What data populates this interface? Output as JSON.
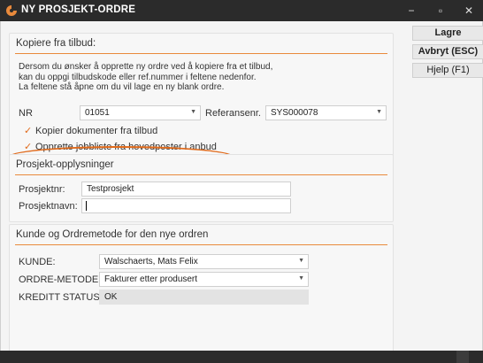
{
  "window": {
    "title": "NY PROSJEKT-ORDRE",
    "app_icon": "order-logo-icon",
    "minimize": "−",
    "maximize": "▫",
    "close": "✕"
  },
  "side_buttons": {
    "save": "Lagre",
    "cancel": "Avbryt (ESC)",
    "help": "Hjelp (F1)"
  },
  "copy_group": {
    "title": "Kopiere fra tilbud:",
    "info": [
      "Dersom du ønsker å opprette ny ordre ved å kopiere fra et tilbud,",
      "kan du oppgi tilbudskode eller ref.nummer i feltene nedenfor.",
      "La feltene stå åpne om du vil lage en ny blank ordre."
    ],
    "nr_label": "NR",
    "nr_value": "01051",
    "ref_label": "Referansenr.",
    "ref_value": "SYS000078",
    "copy_docs": "Kopier dokumenter fra tilbud",
    "create_joblist": "Opprette jobbliste fra hovedposter i anbud",
    "check_mark": "✓"
  },
  "project_group": {
    "title": "Prosjekt-opplysninger",
    "projnr_label": "Prosjektnr:",
    "projnr_value": "Testprosjekt",
    "projname_label": "Prosjektnavn:",
    "projname_value": ""
  },
  "customer_group": {
    "title": "Kunde og Ordremetode for den nye ordren",
    "customer_label": "KUNDE:",
    "customer_value": "Walschaerts, Mats Felix",
    "method_label": "ORDRE-METODE:",
    "method_value": "Fakturer etter produsert",
    "credit_label": "KREDITT STATUS:",
    "credit_value": "OK"
  },
  "icons": {
    "dropdown": "▼"
  },
  "colors": {
    "accent": "#e98a3c",
    "highlight": "#e06a1b",
    "titlebar": "#2b2b2b"
  }
}
